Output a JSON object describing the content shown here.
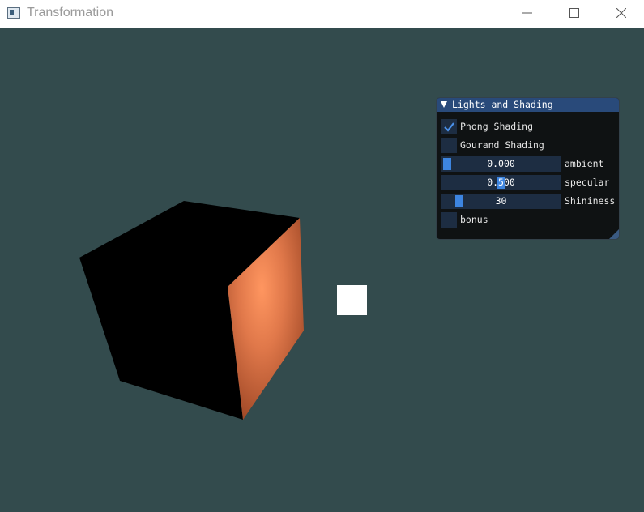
{
  "window": {
    "title": "Transformation"
  },
  "panel": {
    "title": "Lights and Shading",
    "checkboxes": [
      {
        "label": "Phong Shading",
        "checked": true
      },
      {
        "label": "Gourand Shading",
        "checked": false
      }
    ],
    "sliders": [
      {
        "label": "ambient",
        "value_text": "0.000",
        "level": 0.0
      },
      {
        "label": "specular",
        "value_text": "0.500",
        "level": 0.5
      },
      {
        "label": "Shininess",
        "value_text": "30",
        "level": 0.11
      }
    ],
    "bonus": {
      "label": "bonus",
      "checked": false
    }
  },
  "colors": {
    "background": "#334b4d",
    "cube_lit": "#e0784a",
    "cube_dark": "#000000",
    "light": "#ffffff",
    "accent": "#3d85e0",
    "header": "#294a7a"
  }
}
